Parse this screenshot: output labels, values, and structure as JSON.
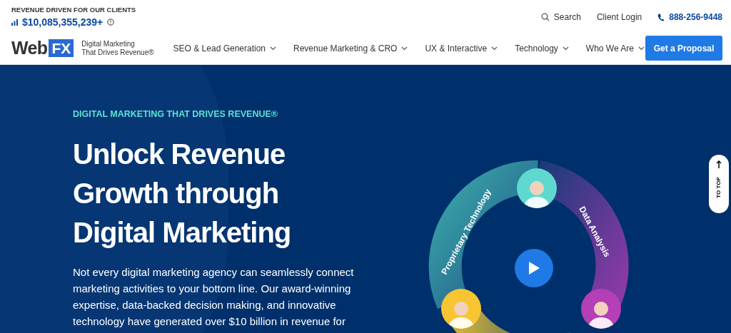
{
  "topbar": {
    "revenue_label": "REVENUE DRIVEN FOR OUR CLIENTS",
    "revenue_value": "$10,085,355,239+",
    "links": [
      {
        "kind": "search",
        "label": "Search"
      },
      {
        "kind": "plain",
        "label": "Client Login"
      },
      {
        "kind": "phone",
        "label": "888-256-9448"
      }
    ]
  },
  "logo": {
    "word": "Web",
    "mark": "FX",
    "tagline_1": "Digital Marketing",
    "tagline_2": "That Drives Revenue®"
  },
  "nav": [
    {
      "label": "SEO & Lead Generation"
    },
    {
      "label": "Revenue Marketing & CRO"
    },
    {
      "label": "UX & Interactive"
    },
    {
      "label": "Technology"
    },
    {
      "label": "Who We Are"
    }
  ],
  "cta": "Get a Proposal",
  "hero": {
    "eyebrow": "DIGITAL MARKETING THAT DRIVES REVENUE®",
    "heading": [
      "Unlock Revenue",
      "Growth through",
      "Digital Marketing"
    ],
    "body": "Not every digital marketing agency can seamlessly connect marketing activities to your bottom line. Our award-winning expertise, data-backed decision making, and innovative technology have generated over $10 billion in revenue for"
  },
  "wheel": {
    "labels": [
      "Proprietary Technology",
      "Data Analysis"
    ],
    "avatars": [
      {
        "color": "#5fd9d0"
      },
      {
        "color": "#f7c531"
      },
      {
        "color": "#b43fb6"
      }
    ]
  },
  "to_top": "TO TOP"
}
